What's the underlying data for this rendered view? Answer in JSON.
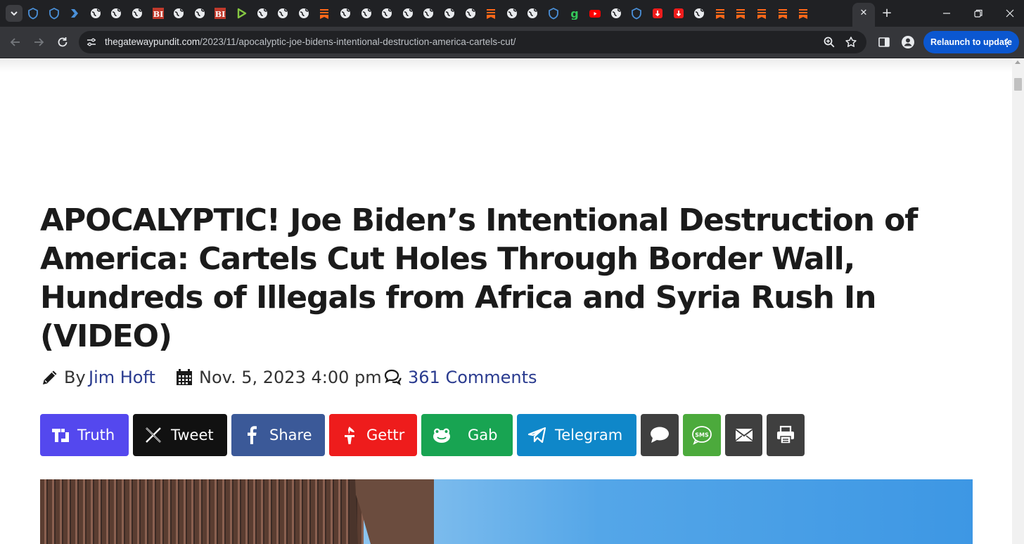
{
  "browser": {
    "tab_count_visible": 41,
    "new_tab_symbol": "+",
    "close_tab_symbol": "✕",
    "url_host": "thegatewaypundit.com",
    "url_path": "/2023/11/apocalyptic-joe-bidens-intentional-destruction-america-cartels-cut/",
    "relaunch_label": "Relaunch to update",
    "accent_color": "#0b57d0"
  },
  "article": {
    "headline": "APOCALYPTIC! Joe Biden’s Intentional Destruction of America: Cartels Cut Holes Through Border Wall, Hundreds of Illegals from Africa and Syria Rush In (VIDEO)",
    "byline_prefix": "By",
    "author": "Jim Hoft",
    "date": "Nov. 5, 2023 4:00 pm",
    "comments": "361 Comments",
    "link_color": "#2a3b8f"
  },
  "share_buttons": [
    {
      "label": "Truth",
      "color": "#5448ee",
      "icon": "truth-social-icon"
    },
    {
      "label": "Tweet",
      "color": "#111111",
      "icon": "x-icon"
    },
    {
      "label": "Share",
      "color": "#3b5998",
      "icon": "facebook-icon"
    },
    {
      "label": "Gettr",
      "color": "#ee1c1c",
      "icon": "gettr-icon"
    },
    {
      "label": "Gab",
      "color": "#18a452",
      "icon": "gab-icon"
    },
    {
      "label": "Telegram",
      "color": "#0f87c9",
      "icon": "telegram-icon"
    },
    {
      "label": "",
      "color": "#3f3f3f",
      "icon": "comment-bubble-icon"
    },
    {
      "label": "",
      "color": "#4caa3c",
      "icon": "sms-icon"
    },
    {
      "label": "",
      "color": "#3f3f3f",
      "icon": "email-icon"
    },
    {
      "label": "",
      "color": "#3f3f3f",
      "icon": "print-icon"
    }
  ],
  "sms_icon_text": "SMS"
}
